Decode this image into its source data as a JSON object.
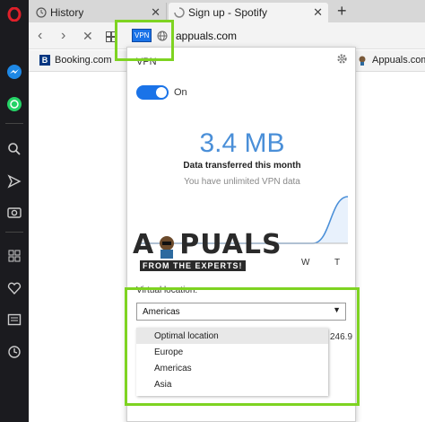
{
  "tabs": [
    {
      "label": "History"
    },
    {
      "label": "Sign up - Spotify"
    }
  ],
  "new_tab": "+",
  "address": {
    "url": "appuals.com",
    "vpn_badge": "VPN"
  },
  "bookmarks": [
    {
      "label": "Booking.com",
      "favicon": "B"
    },
    {
      "label": "Appuals.com",
      "favicon": "appuals-icon"
    }
  ],
  "vpn": {
    "title": "VPN",
    "toggle_label": "On",
    "data_amount": "3.4 MB",
    "data_caption": "Data transferred this month",
    "data_sub": "You have unlimited VPN data",
    "days": [
      "W",
      "T"
    ],
    "virtual_location_label": "Virtual location:",
    "selected_location": "Americas",
    "ip_partial": "246.9",
    "options": [
      "Optimal location",
      "Europe",
      "Americas",
      "Asia"
    ]
  },
  "watermark": {
    "main": "APPUALS",
    "sub": "FROM THE EXPERTS!"
  },
  "colors": {
    "highlight": "#7ed321",
    "accent": "#1a73e8",
    "stat": "#4a8fd8",
    "sidebar": "#1b1b1f"
  },
  "chart_data": {
    "type": "area",
    "series": [
      {
        "values": [
          0,
          0,
          0,
          0,
          0,
          0,
          3.4
        ]
      }
    ]
  }
}
